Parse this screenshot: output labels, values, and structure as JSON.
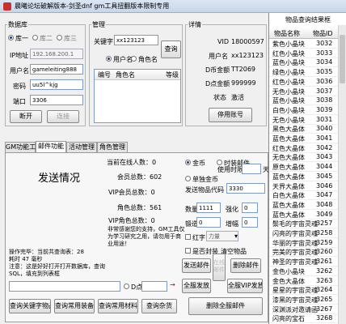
{
  "window": {
    "title": "晨曦论坛破解版本-剑圣dnf gm工具扭翻版本限制专用"
  },
  "db_group": {
    "label": "数据库",
    "radios": [
      "库一",
      "库二",
      "库三"
    ],
    "ip_label": "IP地址",
    "ip_value": "192.168.200.1",
    "user_label": "用户名",
    "user_value": "gameleiting888",
    "pwd_label": "密码",
    "pwd_value": "uu5l^kjg",
    "port_label": "端口",
    "port_value": "3306",
    "disconnect_btn": "断开",
    "connect_btn": "连接"
  },
  "manage_group": {
    "label": "管理",
    "keyword_label": "关键字",
    "keyword_value": "xx123123",
    "query_btn": "查询",
    "radio_user": "用户名",
    "radio_role": "角色名",
    "columns": [
      "编号",
      "角色名",
      "等级"
    ]
  },
  "detail_group": {
    "label": "详情",
    "vid_label": "VID",
    "vid_value": "18000597",
    "user_label": "用户名",
    "user_value": "xx123123",
    "d_label": "D币金额",
    "d_value": "TT2069",
    "dd_label": "D点金额",
    "dd_value": "999999",
    "status_label": "状态",
    "status_value": "激活",
    "disable_btn": "停用账号"
  },
  "tabs": [
    "GM功能工具",
    "邮件功能",
    "活动管理",
    "角色管理"
  ],
  "mail": {
    "send_status": "发送情况",
    "online_label": "当前在线人数：0",
    "member_label": "会员总数：602",
    "vip_label": "VIP会员总数：0",
    "role_label": "角色总数：561",
    "vip_role_label": "VIP角色总数：0",
    "warning_text": "非常感谢您的支持，GM工具仅为学习研究之用，请勿用于商业用途！",
    "radio_gold": "金币",
    "radio_ticket": "时装邮件",
    "radio_single": "单独金币",
    "time_label": "使用时限",
    "time_unit": "天",
    "item_code_label": "发送物品代码",
    "item_code_value": "3330",
    "qty_label": "数量",
    "qty_value": "1111",
    "strengthen_label": "强化",
    "strengthen_value": "0",
    "forge_label": "锻造",
    "forge_value": "0",
    "upgrade_label": "增幅",
    "upgrade_value": "0",
    "red_label": "红字",
    "power_value": "力量",
    "seal_label": "是否封装",
    "clear_btn": "清空物品",
    "online_btn": "在线\n邮件",
    "send_mail_btn": "发送邮件",
    "delete_mail_btn": "删除邮件",
    "all_send_btn": "全服发放",
    "vip_all_send_btn": "全服VIP发放",
    "log_text": "操作完毕：当前共查询表：28\n耗时 47 毫秒\n注意：这是好好打开打开数据库，查询SQL，填充到列表框",
    "d_coin_label": "D点",
    "bottom_btns": [
      "查询关键字物品",
      "查询常用装备",
      "查询常用材料",
      "查询杂货"
    ],
    "delete_all_btn": "删除全服邮件"
  },
  "item_list": {
    "title": "物品查询结果框",
    "columns": [
      "物品名称",
      "物品ID"
    ],
    "rows": [
      [
        "紫色小晶块",
        "3032"
      ],
      [
        "红色小晶块",
        "3033"
      ],
      [
        "蓝色小晶块",
        "3034"
      ],
      [
        "绿色小晶块",
        "3035"
      ],
      [
        "红色小晶块",
        "3036"
      ],
      [
        "无色小晶块",
        "3037"
      ],
      [
        "蓝色小晶块",
        "3038"
      ],
      [
        "白色小晶块",
        "3039"
      ],
      [
        "无色小晶块",
        "3031"
      ],
      [
        "黑色大晶体",
        "3040"
      ],
      [
        "蓝色大晶体",
        "3041"
      ],
      [
        "红色大晶体",
        "3042"
      ],
      [
        "无色大晶体",
        "3043"
      ],
      [
        "原色大晶体",
        "3044"
      ],
      [
        "蓝色大晶体",
        "3045"
      ],
      [
        "天界大晶体",
        "3046"
      ],
      [
        "白色大晶体",
        "3047"
      ],
      [
        "蓝色大晶体",
        "3048"
      ],
      [
        "蓝色大晶体",
        "3049"
      ],
      [
        "鬃毛的宇宙灵魂",
        "3257"
      ],
      [
        "闪亮的宇宙灵魂",
        "3258"
      ],
      [
        "华丽的宇宙灵魂",
        "3259"
      ],
      [
        "完美的宇宙灵魂",
        "3260"
      ],
      [
        "神圣的宇宙灵魂",
        "3261"
      ],
      [
        "金色小晶块",
        "3262"
      ],
      [
        "金色大晶体",
        "3263"
      ],
      [
        "星星的宇宙灵魂",
        "3264"
      ],
      [
        "漆黑的宇宙灵魂",
        "3265"
      ],
      [
        "深渊派对邀请函",
        "3267"
      ],
      [
        "闪亮的宝石",
        "3268"
      ]
    ]
  }
}
